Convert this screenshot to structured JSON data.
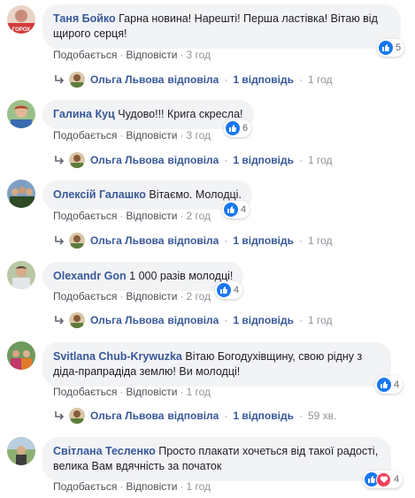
{
  "common": {
    "like_label": "Подобається",
    "reply_label": "Відповісти",
    "dot": "·"
  },
  "comments": [
    {
      "author": "Таня Бойко",
      "text": "Гарна новина! Нарешті! Перша ластівка! Вітаю від щирого серця!",
      "time": "3 год",
      "reaction_count": "5",
      "reply": {
        "author": "Ольга Львова",
        "verb": "відповіла",
        "count": "1 відповідь",
        "time": "1 год"
      }
    },
    {
      "author": "Галина Куц",
      "text": "Чудово!!! Крига скресла!",
      "time": "3 год",
      "reaction_count": "6",
      "reply": {
        "author": "Ольга Львова",
        "verb": "відповіла",
        "count": "1 відповідь",
        "time": "1 год"
      }
    },
    {
      "author": "Олексій Галашко",
      "text": "Вітаємо. Молодці.",
      "time": "2 год",
      "reaction_count": "4",
      "reply": {
        "author": "Ольга Львова",
        "verb": "відповіла",
        "count": "1 відповідь",
        "time": "1 год"
      }
    },
    {
      "author": "Olexandr Gon",
      "text": "1 000 разів молодці!",
      "time": "2 год",
      "reaction_count": "4",
      "reply": {
        "author": "Ольга Львова",
        "verb": "відповіла",
        "count": "1 відповідь",
        "time": "1 год"
      }
    },
    {
      "author": "Svitlana Chub-Krywuzka",
      "text": "Вітаю Богодухівщину, свою рідну з діда-прапрадіда землю! Ви молодці!",
      "time": "1 год",
      "reaction_count": "4",
      "reply": {
        "author": "Ольга Львова",
        "verb": "відповіла",
        "count": "1 відповідь",
        "time": "59 хв."
      }
    },
    {
      "author": "Світлана Тесленко",
      "text": "Просто плакати хочеться від такої радості, велика Вам вдячність за початок",
      "time": "1 год",
      "reaction_count": "4"
    }
  ],
  "colors": {
    "link": "#385898",
    "bubble": "#f2f3f5",
    "like": "#1877f2",
    "love": "#f33e58",
    "meta": "#90949c"
  },
  "icons": {
    "like": "thumbs-up-icon",
    "love": "heart-icon",
    "reply_arrow": "reply-arrow-icon"
  }
}
